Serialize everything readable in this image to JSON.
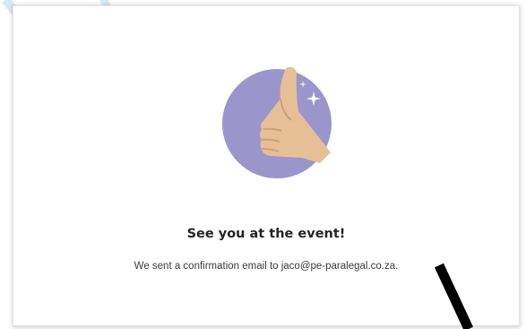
{
  "confirmation": {
    "title": "See you at the event!",
    "message": "We sent a confirmation email to jaco@pe-paralegal.co.za."
  },
  "illustration": {
    "icon": "thumbs-up-icon",
    "circle_color": "#9b95cc",
    "hand_color": "#e7bf97",
    "sparkle_color": "#ffffff"
  },
  "annotation": {
    "stroke_color": "#000000"
  }
}
